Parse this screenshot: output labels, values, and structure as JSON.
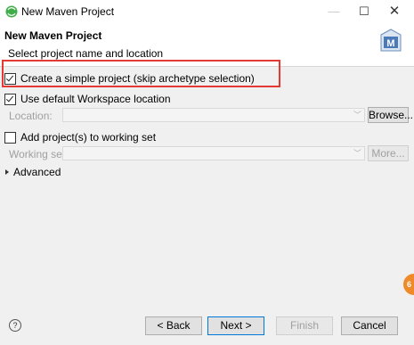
{
  "window": {
    "title": "New Maven Project",
    "min_glyph": "—",
    "max_glyph": "☐",
    "close_glyph": "✕",
    "app_icon": "eclipse-icon"
  },
  "header": {
    "title": "New Maven Project",
    "description": "Select project name and location",
    "logo_text": "M"
  },
  "options": {
    "simple_project": {
      "label": "Create a simple project (skip archetype selection)",
      "checked": true
    },
    "default_workspace": {
      "label": "Use default Workspace location",
      "checked": true
    },
    "location_label": "Location:",
    "location_value": "",
    "browse_label": "Browse...",
    "working_set_check": {
      "label": "Add project(s) to working set",
      "checked": false
    },
    "working_set_label": "Working set:",
    "working_set_value": "",
    "more_label": "More...",
    "advanced_label": "Advanced"
  },
  "footer": {
    "help_glyph": "?",
    "back_label": "< Back",
    "next_label": "Next >",
    "finish_label": "Finish",
    "cancel_label": "Cancel"
  },
  "overlay": {
    "badge_text": "6"
  },
  "colors": {
    "highlight": "#e53935",
    "accent": "#0078d7",
    "eclipse_green": "#3fae49",
    "maven_blue": "#4a7ab8",
    "badge_orange": "#ef8a2a"
  }
}
